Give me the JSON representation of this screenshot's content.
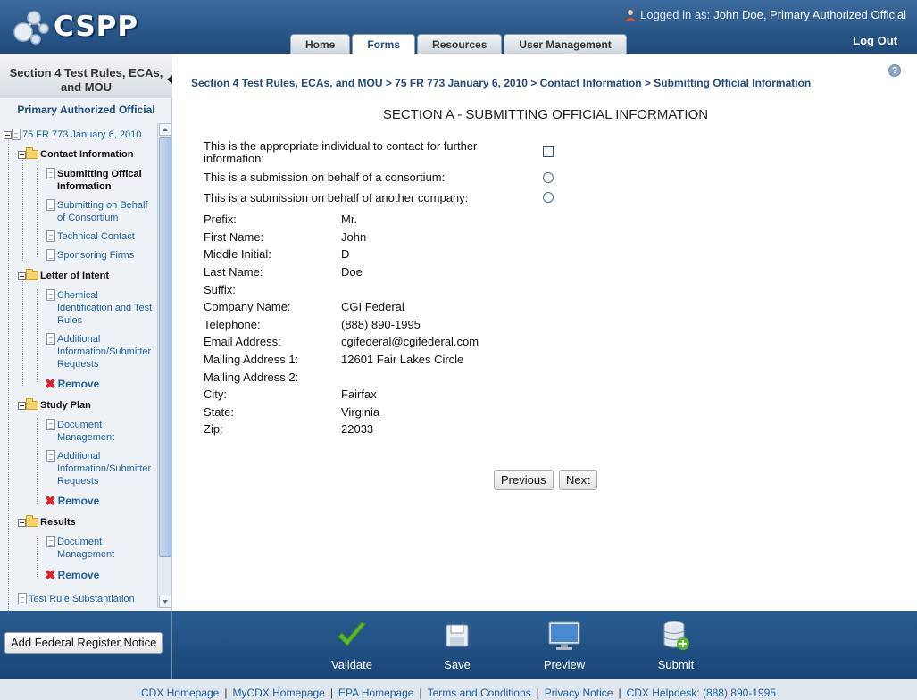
{
  "header": {
    "logo_text": "CSPP",
    "logged_in_label": "Logged in as:",
    "logged_in_user": "John Doe, Primary Authorized Official",
    "logout_label": "Log Out",
    "tabs": [
      {
        "label": "Home",
        "active": false
      },
      {
        "label": "Forms",
        "active": true
      },
      {
        "label": "Resources",
        "active": false
      },
      {
        "label": "User Management",
        "active": false
      }
    ]
  },
  "sidebar": {
    "title_line1": "Section 4 Test Rules, ECAs,",
    "title_line2": "and MOU",
    "role": "Primary Authorized Official",
    "tree": {
      "root": "75 FR 773 January 6, 2010",
      "contact_info": "Contact Information",
      "submitting_official_1": "Submitting Offical",
      "submitting_official_2": "Information",
      "submitting_behalf_1": "Submitting on Behalf",
      "submitting_behalf_2": "of Consortium",
      "technical_contact": "Technical Contact",
      "sponsoring_firms": "Sponsoring Firms",
      "letter_of_intent": "Letter of Intent",
      "chemical_1": "Chemical",
      "chemical_2": "Identification and Test",
      "chemical_3": "Rules",
      "additional_1": "Additional",
      "additional_2": "Information/Submitter",
      "additional_3": "Requests",
      "remove": "Remove",
      "study_plan": "Study Plan",
      "docmgmt_1": "Document",
      "docmgmt_2": "Management",
      "results": "Results",
      "test_rule": "Test Rule Substantiation"
    }
  },
  "main": {
    "breadcrumb": "Section 4 Test Rules, ECAs, and MOU > 75 FR 773 January 6, 2010 > Contact Information > Submitting Official Information",
    "section_title": "SECTION A - SUBMITTING OFFICIAL INFORMATION",
    "questions": {
      "contact_1": "This is the appropriate individual to contact for further",
      "contact_2": "information:",
      "consortium": "This is a submission on behalf of a consortium:",
      "another_company": "This is a submission on behalf of another company:"
    },
    "fields": [
      {
        "label": "Prefix:",
        "value": "Mr."
      },
      {
        "label": "First Name:",
        "value": "John"
      },
      {
        "label": "Middle Initial:",
        "value": "D"
      },
      {
        "label": "Last Name:",
        "value": "Doe"
      },
      {
        "label": "Suffix:",
        "value": ""
      },
      {
        "label": "Company Name:",
        "value": "CGI Federal"
      },
      {
        "label": "Telephone:",
        "value": "(888) 890-1995"
      },
      {
        "label": "Email Address:",
        "value": "cgifederal@cgifederal.com"
      },
      {
        "label": "Mailing Address 1:",
        "value": "12601 Fair Lakes Circle"
      },
      {
        "label": "Mailing Address 2:",
        "value": ""
      },
      {
        "label": "City:",
        "value": "Fairfax"
      },
      {
        "label": "State:",
        "value": "Virginia"
      },
      {
        "label": "Zip:",
        "value": "22033"
      }
    ],
    "previous_label": "Previous",
    "next_label": "Next"
  },
  "bottombar": {
    "add_fed_label": "Add Federal Register Notice",
    "validate_label": "Validate",
    "save_label": "Save",
    "preview_label": "Preview",
    "submit_label": "Submit"
  },
  "footer": {
    "links": [
      "CDX Homepage",
      "MyCDX Homepage",
      "EPA Homepage",
      "Terms and Conditions",
      "Privacy Notice",
      "CDX Helpdesk: (888) 890-1995"
    ]
  },
  "colors": {
    "header_blue": "#1f4a7a",
    "link_blue": "#1f5f9f",
    "remove_red": "#d8242b",
    "validate_green": "#5cb82a"
  }
}
